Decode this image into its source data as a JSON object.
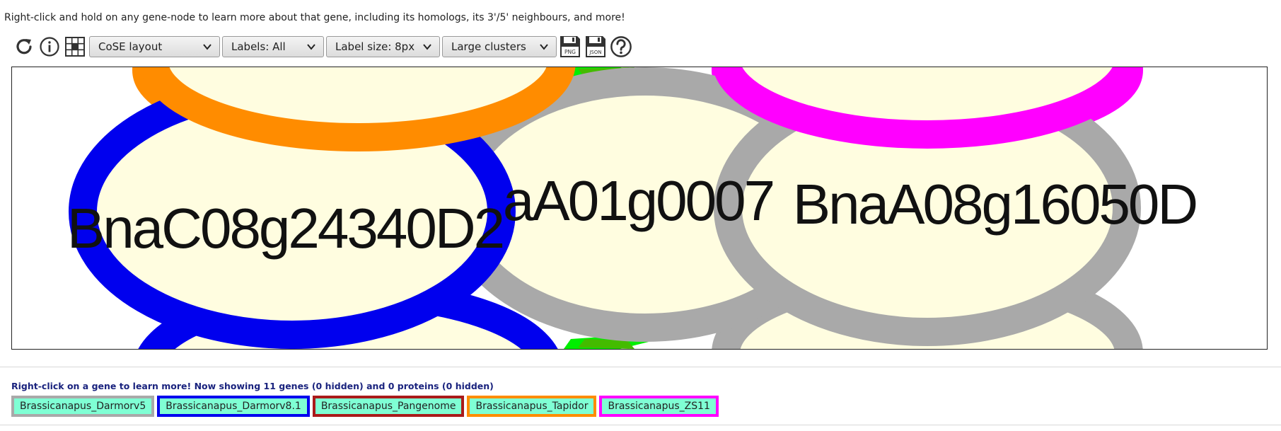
{
  "hint_text": "Right-click and hold on any gene-node to learn more about that gene, including its homologs, its 3'/5' neighbours, and more!",
  "toolbar": {
    "icons": [
      "reset-icon",
      "info-icon",
      "grid-icon"
    ],
    "layout_select": "CoSE layout",
    "labels_select": "Labels: All",
    "label_size_select": "Label size: 8px",
    "clusters_select": "Large clusters",
    "save_png_label": "PNG",
    "save_json_label": "JSON",
    "help_icon": "help-icon"
  },
  "graph": {
    "node_fill": "#fffde0",
    "nodes": [
      {
        "label": "BnaC08g24340D2",
        "border_color": "#0000ee"
      },
      {
        "label": "aA01g0007",
        "border_color": "#a9a9a9"
      },
      {
        "label": "BnaA08g16050D",
        "border_color": "#a9a9a9"
      }
    ],
    "partial_node_colors": [
      "#ff8c00",
      "#ff00ff",
      "#0000ee",
      "#a9a9a9"
    ],
    "edge_colors": [
      "#00ee00",
      "#44bb00"
    ]
  },
  "status_text": "Right-click on a gene to learn more! Now showing 11 genes (0 hidden) and 0 proteins (0 hidden)",
  "legend": [
    {
      "label": "Brassicanapus_Darmorv5",
      "color": "#a9a9a9"
    },
    {
      "label": "Brassicanapus_Darmorv8.1",
      "color": "#0000ee"
    },
    {
      "label": "Brassicanapus_Pangenome",
      "color": "#aa1a1a"
    },
    {
      "label": "Brassicanapus_Tapidor",
      "color": "#ff8c00"
    },
    {
      "label": "Brassicanapus_ZS11",
      "color": "#ff00ff"
    }
  ],
  "legend_fill": "#7fffd4"
}
